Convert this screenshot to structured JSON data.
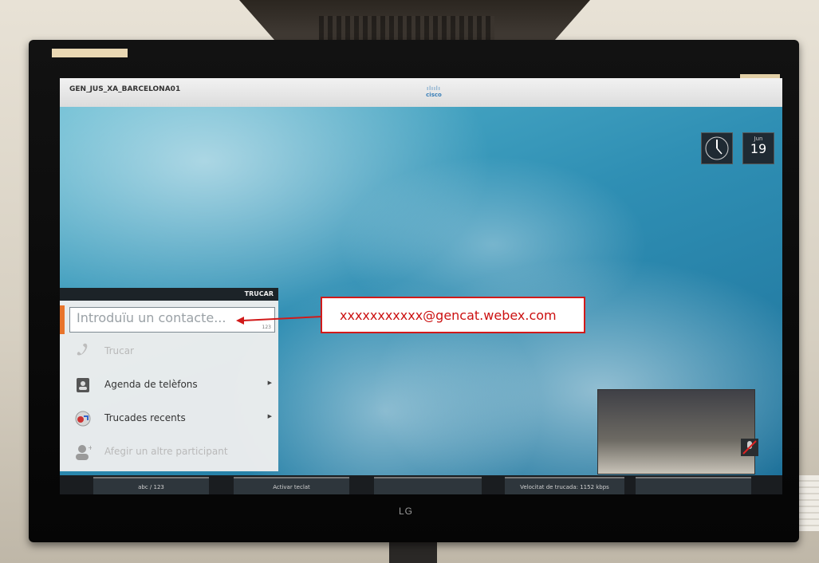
{
  "system": {
    "name": "GEN_JUS_XA_BARCELONA01"
  },
  "brand": {
    "logo_text": "cisco",
    "monitor_logo": "LG"
  },
  "calendar": {
    "month": "Jun",
    "day": "19"
  },
  "call_panel": {
    "header": "TRUCAR",
    "entry_placeholder": "Introduïu un contacte...",
    "entry_mode": "123",
    "items": [
      {
        "label": "Trucar",
        "icon": "phone-icon",
        "enabled": false
      },
      {
        "label": "Agenda de telèfons",
        "icon": "phonebook-icon",
        "enabled": true,
        "submenu": true
      },
      {
        "label": "Trucades recents",
        "icon": "recent-calls-icon",
        "enabled": true,
        "submenu": true
      },
      {
        "label": "Afegir un altre participant",
        "icon": "add-participant-icon",
        "enabled": false
      }
    ]
  },
  "softkeys": [
    "abc / 123",
    "Activar teclat",
    "",
    "Velocitat de trucada: 1152 kbps",
    ""
  ],
  "annotation": {
    "text": "xxxxxxxxxxx@gencat.webex.com",
    "color": "#d11a1a"
  },
  "colors": {
    "accent": "#e8742b",
    "header_dark": "#1c2328"
  }
}
